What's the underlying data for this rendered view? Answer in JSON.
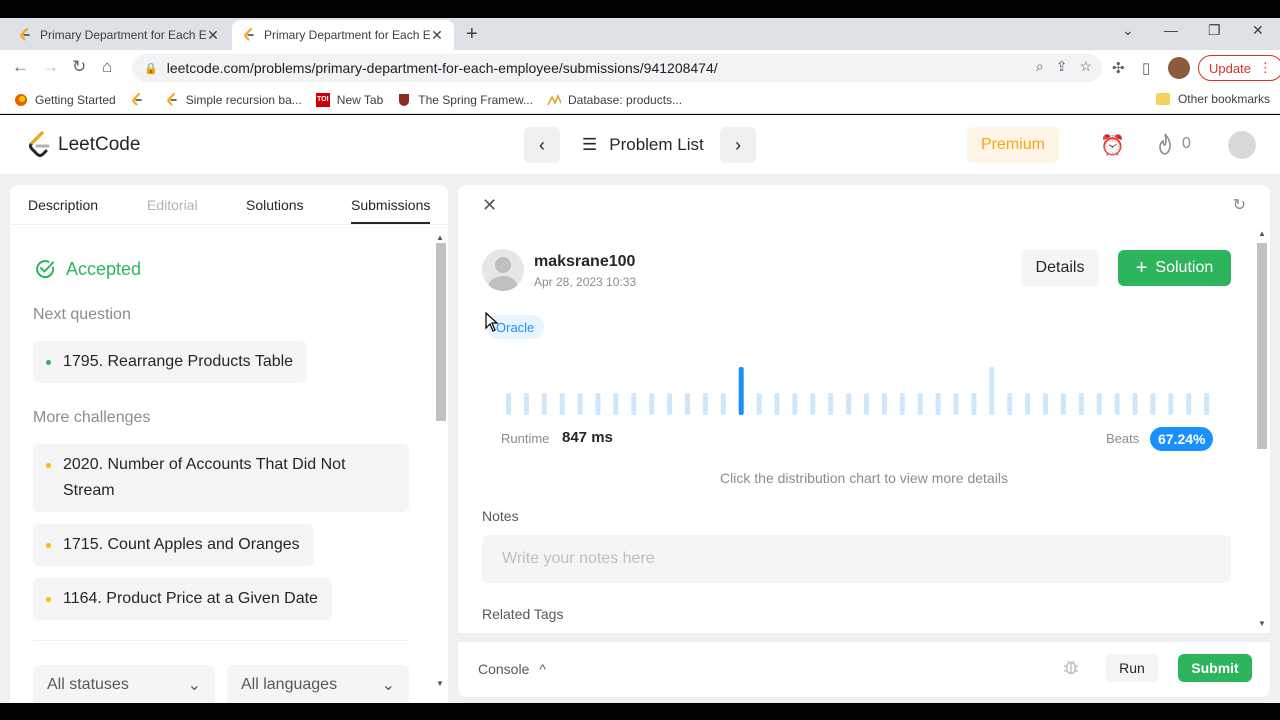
{
  "browser": {
    "tabs": [
      {
        "title": "Primary Department for Each Em",
        "active": false
      },
      {
        "title": "Primary Department for Each Em",
        "active": true
      }
    ],
    "url": "leetcode.com/problems/primary-department-for-each-employee/submissions/941208474/",
    "update_label": "Update",
    "bookmarks": [
      {
        "label": "Getting Started",
        "icon": "firefox-icon"
      },
      {
        "label": "",
        "icon": "leetcode-icon"
      },
      {
        "label": "Simple recursion ba...",
        "icon": "leetcode-icon"
      },
      {
        "label": "New Tab",
        "icon": "toi-icon"
      },
      {
        "label": "The Spring Framew...",
        "icon": "shield-icon"
      },
      {
        "label": "Database: products...",
        "icon": "aws-icon"
      }
    ],
    "other_bookmarks": "Other bookmarks"
  },
  "header": {
    "brand": "LeetCode",
    "problem_list": "Problem List",
    "premium": "Premium",
    "streak_count": "0"
  },
  "left": {
    "tabs": [
      "Description",
      "Editorial",
      "Solutions",
      "Submissions"
    ],
    "status": "Accepted",
    "next_question_label": "Next question",
    "next_question": "1795. Rearrange Products Table",
    "more_challenges_label": "More challenges",
    "challenges": [
      "2020. Number of Accounts That Did Not Stream",
      "1715. Count Apples and Oranges",
      "1164. Product Price at a Given Date"
    ],
    "filters": [
      "All statuses",
      "All languages"
    ]
  },
  "submission": {
    "username": "maksrane100",
    "date": "Apr 28, 2023 10:33",
    "details_label": "Details",
    "solution_label": "Solution",
    "language": "Oracle",
    "runtime_label": "Runtime",
    "runtime_value": "847 ms",
    "beats_label": "Beats",
    "beats_value": "67.24%",
    "hint": "Click the distribution chart to view more details",
    "notes_label": "Notes",
    "notes_placeholder": "Write your notes here",
    "related_tags_label": "Related Tags"
  },
  "console": {
    "console_label": "Console",
    "run_label": "Run",
    "submit_label": "Submit"
  },
  "colors": {
    "accent_green": "#2db55d",
    "accent_blue": "#1a90ff",
    "premium_orange": "#ffa116"
  }
}
